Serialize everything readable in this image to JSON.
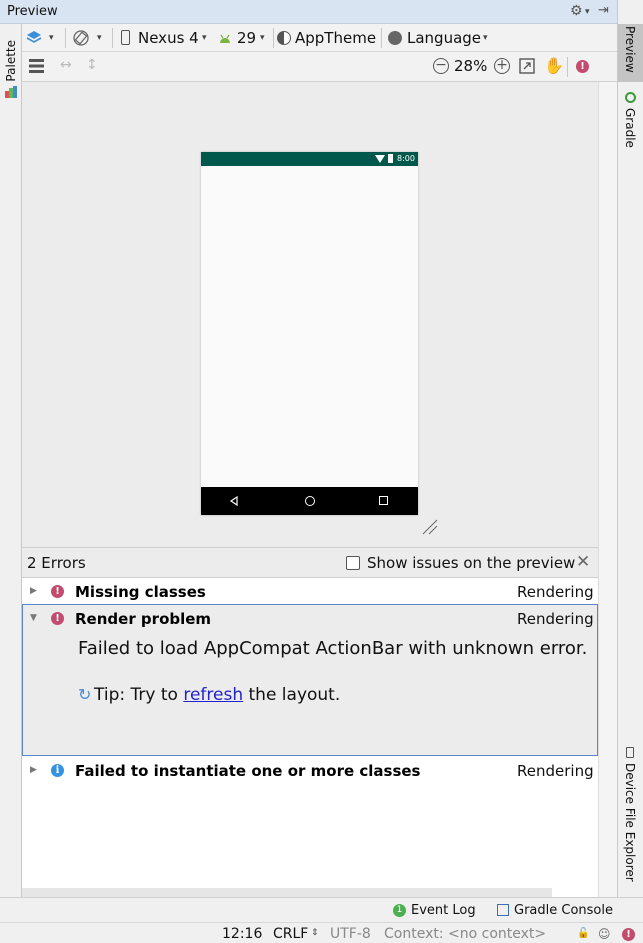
{
  "window": {
    "title": "Preview"
  },
  "left_tool_window": {
    "label": "Palette"
  },
  "right_tool_windows": [
    {
      "label": "Preview"
    },
    {
      "label": "Gradle"
    },
    {
      "label": "Device File Explorer"
    }
  ],
  "toolbar": {
    "device": "Nexus 4",
    "api_level": "29",
    "theme": "AppTheme",
    "language": "Language",
    "zoom": "28%"
  },
  "device_preview": {
    "clock": "8:00",
    "colors": {
      "status_bar": "#00574b",
      "nav_bar": "#000000",
      "screen": "#fafafa"
    }
  },
  "issues": {
    "header": "2 Errors",
    "show_on_preview_label": "Show issues on the preview",
    "show_on_preview_checked": false,
    "items": [
      {
        "title": "Missing classes",
        "category": "Rendering",
        "severity": "error",
        "expanded": false
      },
      {
        "title": "Render problem",
        "category": "Rendering",
        "severity": "error",
        "expanded": true,
        "message": "Failed to load AppCompat ActionBar with unknown error.",
        "tip_prefix": "Tip: Try to ",
        "tip_link": "refresh",
        "tip_suffix": " the layout."
      },
      {
        "title": "Failed to instantiate one or more classes",
        "category": "Rendering",
        "severity": "info",
        "expanded": false
      }
    ]
  },
  "bottom_bar": {
    "event_log_badge": "1",
    "event_log": "Event Log",
    "gradle_console": "Gradle Console"
  },
  "status_line": {
    "cursor": "12:16",
    "line_sep": "CRLF",
    "encoding": "UTF-8",
    "context": "Context: <no context>"
  }
}
